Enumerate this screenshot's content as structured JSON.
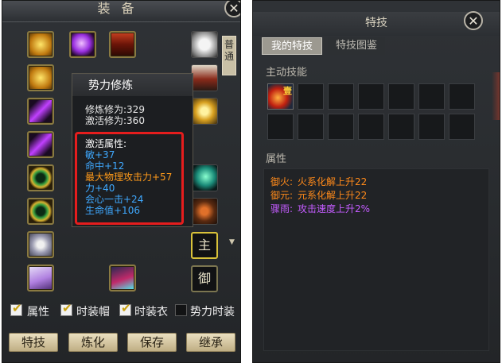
{
  "left_panel": {
    "title": "装备",
    "side_tab": "普通",
    "tooltip": {
      "title": "势力修炼",
      "stats": [
        "修炼修为:329",
        "激活修为:360"
      ],
      "attr_header": "激活属性:",
      "attributes": [
        {
          "text": "敏+37",
          "color": "#3fa9ff"
        },
        {
          "text": "命中+12",
          "color": "#3fa9ff"
        },
        {
          "text": "最大物理攻击力+57",
          "color": "#ff9a1a"
        },
        {
          "text": "力+40",
          "color": "#3fa9ff"
        },
        {
          "text": "会心一击+24",
          "color": "#3fa9ff"
        },
        {
          "text": "生命值+106",
          "color": "#3fa9ff"
        }
      ]
    },
    "role_buttons": [
      {
        "label": "主",
        "active": true
      },
      {
        "label": "御",
        "active": false
      }
    ],
    "checkboxes": [
      {
        "label": "属性",
        "checked": true
      },
      {
        "label": "时装帽",
        "checked": true
      },
      {
        "label": "时装衣",
        "checked": true
      },
      {
        "label": "势力时装",
        "checked": false
      }
    ],
    "buttons": [
      "特技",
      "炼化",
      "保存",
      "继承"
    ],
    "equipment_icons": [
      "feather-icon",
      "ring-icon",
      "orb-icon",
      "shield-icon",
      "bust-icon",
      "mask-icon",
      "gold-bag-icon",
      "horse-icon",
      "beast-icon",
      "cat-icon",
      "book-icon",
      "boot-icon",
      "chest-icon"
    ]
  },
  "right_panel": {
    "title": "特技",
    "tabs": [
      {
        "label": "我的特技",
        "active": true
      },
      {
        "label": "特技图鉴",
        "active": false
      }
    ],
    "active_skills_label": "主动技能",
    "skill_badge": "壹",
    "attributes_label": "属性",
    "attributes": [
      {
        "name": "御火:",
        "desc": "火系化解上升22",
        "name_color": "#ff8a1a",
        "desc_color": "#ff8a1a"
      },
      {
        "name": "御元:",
        "desc": "元系化解上升22",
        "name_color": "#ff8a1a",
        "desc_color": "#ff8a1a"
      },
      {
        "name": "骤雨:",
        "desc": "攻击速度上升2%",
        "name_color": "#c45cff",
        "desc_color": "#c45cff"
      }
    ]
  },
  "colors": {
    "highlight_border": "#e51d1d",
    "item_frame": "#8a7a42",
    "button_bg": "#d9cba4"
  }
}
